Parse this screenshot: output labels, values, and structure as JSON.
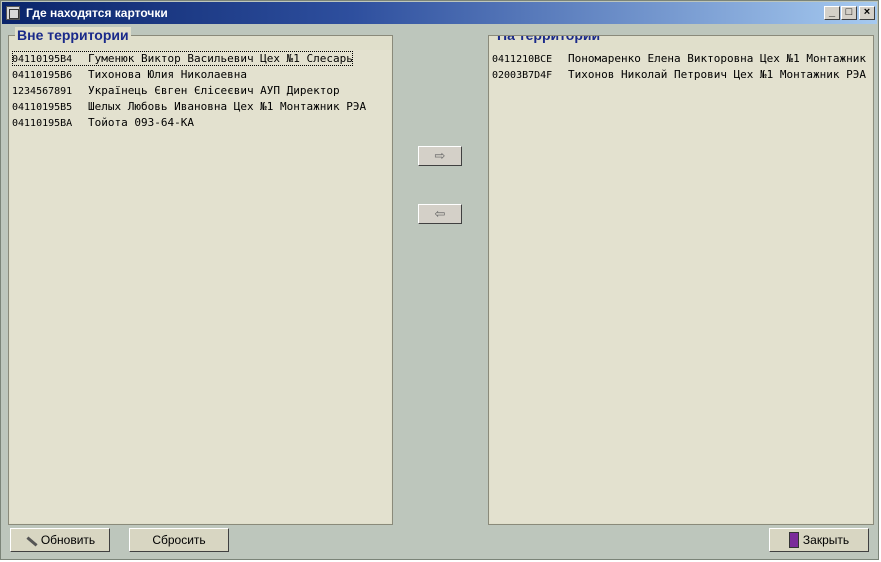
{
  "window": {
    "title": "Где находятся карточки",
    "controls": {
      "minimize": "_",
      "maximize": "□",
      "close": "×"
    }
  },
  "outside": {
    "title": "Вне территории",
    "rows": [
      {
        "code": "04110195B4",
        "text": "Гуменюк Виктор Васильевич Цех №1 Слесарь"
      },
      {
        "code": "04110195B6",
        "text": "Тихонова Юлия Николаевна"
      },
      {
        "code": "1234567891",
        "text": "Українець Євген Єлісеєвич АУП Директор"
      },
      {
        "code": "04110195B5",
        "text": "Шелых Любовь Ивановна Цех №1 Монтажник РЭА"
      },
      {
        "code": "04110195BA",
        "text": "Тойота 093-64-КА"
      }
    ]
  },
  "inside": {
    "title": "На территории",
    "rows": [
      {
        "code": "0411210BCE",
        "text": "Пономаренко Елена Викторовна Цех №1 Монтажник"
      },
      {
        "code": "02003B7D4F",
        "text": "Тихонов Николай Петрович Цех №1 Монтажник РЭА"
      }
    ]
  },
  "transfer": {
    "to_inside": "⇨",
    "to_outside": "⇦"
  },
  "buttons": {
    "refresh": "Обновить",
    "reset": "Сбросить",
    "close": "Закрыть"
  },
  "icons": {
    "window": "app-icon",
    "refresh": "pencil-icon",
    "close": "door-exit-icon"
  }
}
